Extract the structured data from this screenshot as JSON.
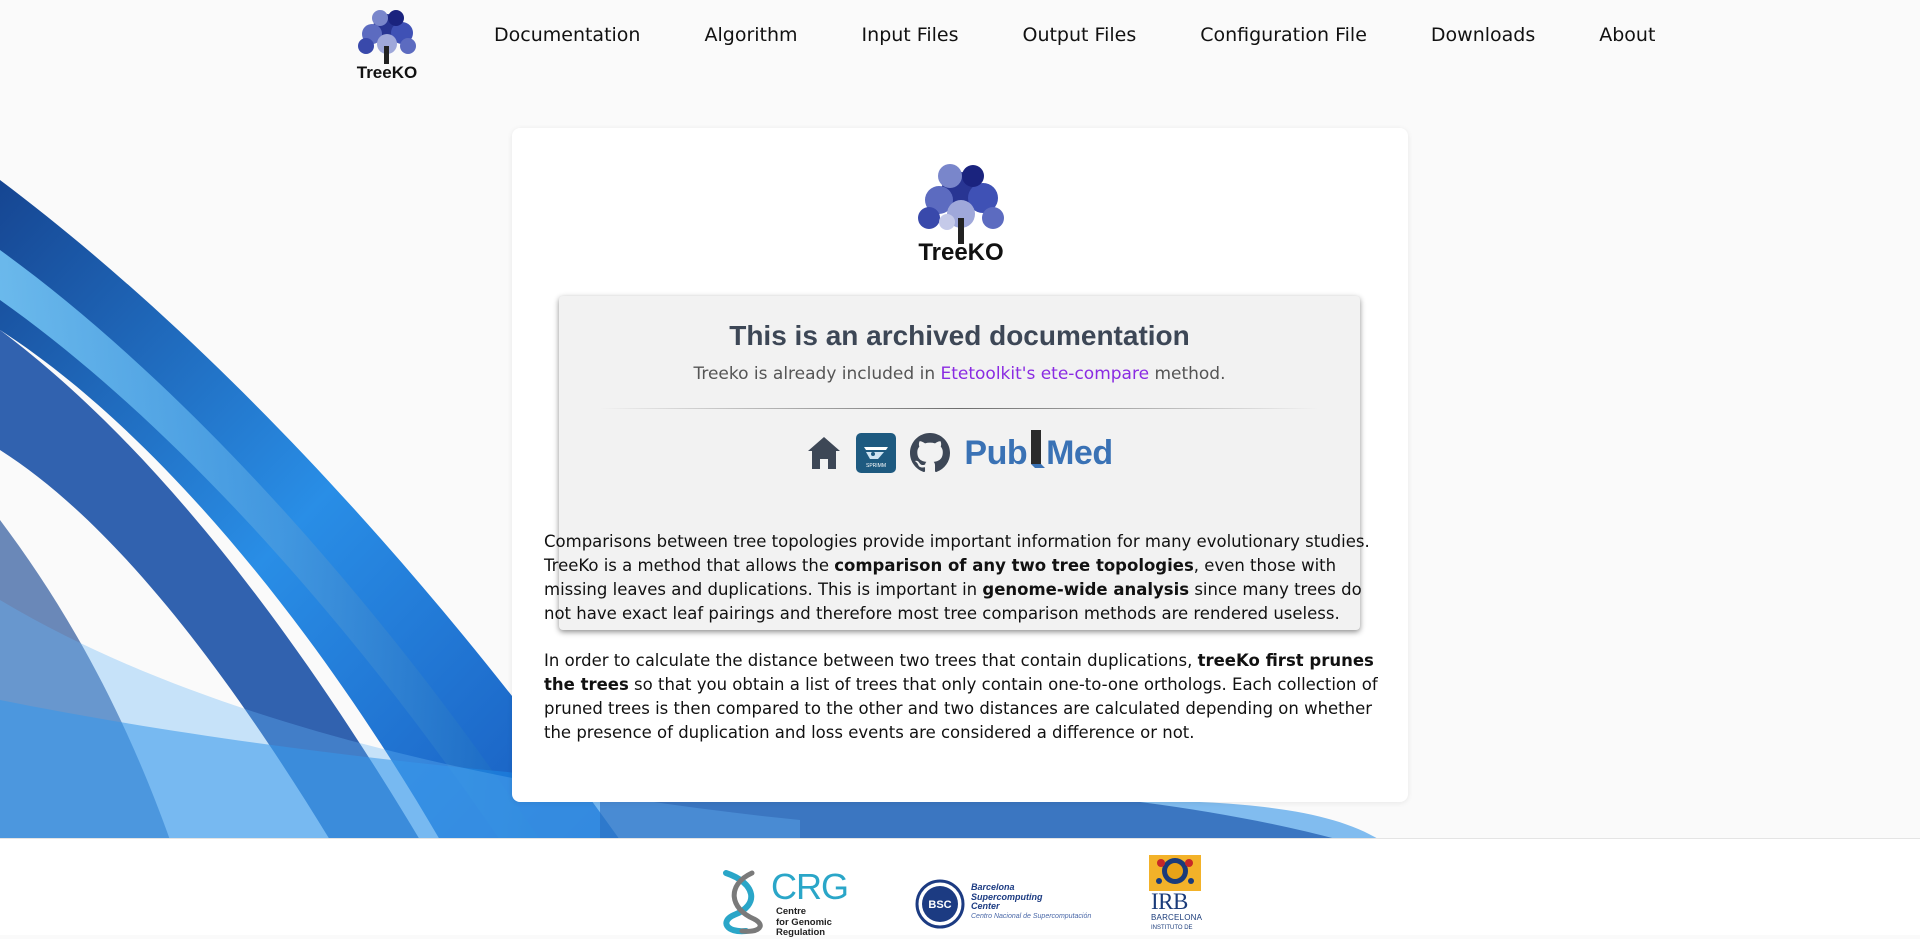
{
  "app": {
    "logo_text": "TreeKO"
  },
  "nav": {
    "items": [
      {
        "label": "Documentation"
      },
      {
        "label": "Algorithm"
      },
      {
        "label": "Input Files"
      },
      {
        "label": "Output Files"
      },
      {
        "label": "Configuration File"
      },
      {
        "label": "Downloads"
      },
      {
        "label": "About"
      }
    ]
  },
  "archive": {
    "title": "This is an archived documentation",
    "note_prefix": "Treeko is already included in ",
    "note_link": "Etetoolkit's ete-compare",
    "note_suffix": " method.",
    "icons": [
      "home-icon",
      "sprimm-icon",
      "github-icon",
      "pubmed-logo"
    ],
    "sprimm_label": "SPRIMM",
    "pubmed_pub": "Pub",
    "pubmed_med": "Med"
  },
  "intro": {
    "p1": [
      {
        "text": "Comparisons between tree topologies provide important information for many evolutionary studies. TreeKo is a method that allows the ",
        "bold": false
      },
      {
        "text": "comparison of any two tree topologies",
        "bold": true
      },
      {
        "text": ", even those with missing leaves and duplications. This is important in ",
        "bold": false
      },
      {
        "text": "genome-wide analysis",
        "bold": true
      },
      {
        "text": " since many trees do not have exact leaf pairings and therefore most tree comparison methods are rendered useless.",
        "bold": false
      }
    ],
    "p2": [
      {
        "text": "In order to calculate the distance between two trees that contain duplications, ",
        "bold": false
      },
      {
        "text": "treeKo first prunes the trees",
        "bold": true
      },
      {
        "text": " so that you obtain a list of trees that only contain one-to-one orthologs. Each collection of pruned trees is then compared to the other and two distances are calculated depending on whether the presence of duplication and loss events are considered a difference or not.",
        "bold": false
      }
    ]
  },
  "footer": {
    "crg": {
      "abbr": "CRG",
      "lines": "Centre\nfor Genomic\nRegulation"
    },
    "bsc": {
      "circle": "BSC",
      "lines": "Barcelona\nSupercomputing\nCenter",
      "sub": "Centro Nacional de Supercomputación"
    },
    "irb": {
      "abbr": "IRB",
      "line": "BARCELONA",
      "sub": "INSTITUTO DE"
    }
  },
  "colors": {
    "link": "#8a2be2",
    "archive_title": "#3d4756",
    "pubmed": "#3a72b5",
    "swoosh": "#1a6fd6"
  }
}
